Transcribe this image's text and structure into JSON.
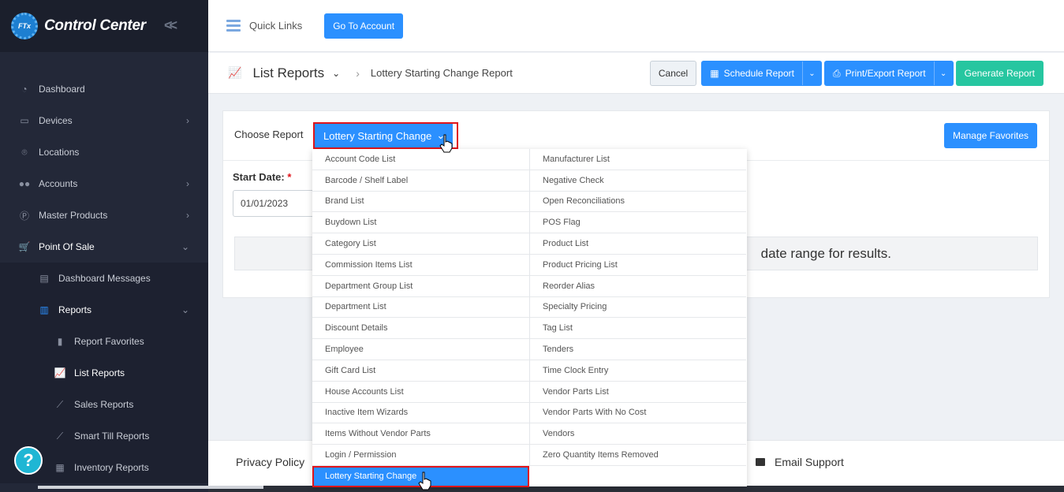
{
  "brand": {
    "logo_text": "FTx",
    "name": "Control Center"
  },
  "sidebar": {
    "items": [
      {
        "label": "Dashboard",
        "icon": "dashboard-icon",
        "chevron": false
      },
      {
        "label": "Devices",
        "icon": "devices-icon",
        "chevron": true
      },
      {
        "label": "Locations",
        "icon": "location-pin-icon",
        "chevron": false
      },
      {
        "label": "Accounts",
        "icon": "users-icon",
        "chevron": true
      },
      {
        "label": "Master Products",
        "icon": "p-circle-icon",
        "chevron": true
      },
      {
        "label": "Point Of Sale",
        "icon": "cart-icon",
        "chevron": true,
        "expanded": true
      }
    ],
    "pos_children": [
      {
        "label": "Dashboard Messages",
        "icon": "message-icon"
      },
      {
        "label": "Reports",
        "icon": "bar-chart-icon",
        "expanded": true
      }
    ],
    "report_children": [
      {
        "label": "Report Favorites",
        "icon": "bookmark-icon"
      },
      {
        "label": "List Reports",
        "icon": "line-chart-icon",
        "current": true
      },
      {
        "label": "Sales Reports",
        "icon": "line-chart-icon"
      },
      {
        "label": "Smart Till Reports",
        "icon": "line-chart-icon"
      },
      {
        "label": "Inventory Reports",
        "icon": "inventory-icon"
      }
    ],
    "help_label": "?"
  },
  "topbar": {
    "quick_links": "Quick Links",
    "go_to_account": "Go To Account"
  },
  "breadcrumb": {
    "section": "List Reports",
    "page": "Lottery Starting Change Report"
  },
  "actions": {
    "cancel": "Cancel",
    "schedule": "Schedule Report",
    "print_export": "Print/Export Report",
    "generate": "Generate Report"
  },
  "report": {
    "choose_label": "Choose Report",
    "selected": "Lottery Starting Change",
    "manage_favorites": "Manage Favorites",
    "start_date_label": "Start Date:",
    "required_mark": "*",
    "start_date_value": "01/01/2023",
    "info_text": "date range for results."
  },
  "dropdown": {
    "left": [
      "Account Code List",
      "Barcode / Shelf Label",
      "Brand List",
      "Buydown List",
      "Category List",
      "Commission Items List",
      "Department Group List",
      "Department List",
      "Discount Details",
      "Employee",
      "Gift Card List",
      "House Accounts List",
      "Inactive Item Wizards",
      "Items Without Vendor Parts",
      "Login / Permission",
      "Lottery Starting Change"
    ],
    "right": [
      "Manufacturer List",
      "Negative Check",
      "Open Reconciliations",
      "POS Flag",
      "Product List",
      "Product Pricing List",
      "Reorder Alias",
      "Specialty Pricing",
      "Tag List",
      "Tenders",
      "Time Clock Entry",
      "Vendor Parts List",
      "Vendor Parts With No Cost",
      "Vendors",
      "Zero Quantity Items Removed"
    ],
    "selected_index": 15
  },
  "footer": {
    "privacy": "Privacy Policy",
    "email_support": "Email Support"
  },
  "colors": {
    "primary": "#2b90ff",
    "success": "#26c6a0",
    "highlight": "#e0141b",
    "sidebar": "#232838"
  }
}
